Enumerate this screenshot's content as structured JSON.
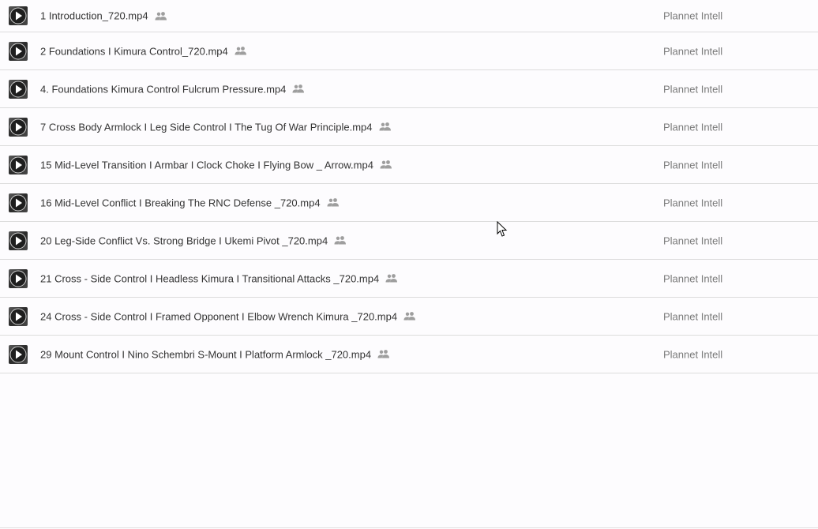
{
  "files": [
    {
      "name": "1 Introduction_720.mp4",
      "owner": "Plannet Intell",
      "icon": "video-play-icon",
      "shared": true
    },
    {
      "name": "2 Foundations I Kimura Control_720.mp4",
      "owner": "Plannet Intell",
      "icon": "video-play-icon",
      "shared": true
    },
    {
      "name": "4. Foundations  Kimura Control  Fulcrum Pressure.mp4",
      "owner": "Plannet Intell",
      "icon": "video-play-icon",
      "shared": true
    },
    {
      "name": "7 Cross Body Armlock I Leg Side Control I The Tug Of War Principle.mp4",
      "owner": "Plannet Intell",
      "icon": "video-play-icon",
      "shared": true
    },
    {
      "name": "15 Mid-Level Transition I Armbar I Clock Choke I Flying Bow _ Arrow.mp4",
      "owner": "Plannet Intell",
      "icon": "video-play-icon",
      "shared": true
    },
    {
      "name": "16 Mid-Level Conflict I Breaking The RNC Defense _720.mp4",
      "owner": "Plannet Intell",
      "icon": "video-play-icon",
      "shared": true
    },
    {
      "name": "20 Leg-Side Conflict  Vs. Strong Bridge I Ukemi Pivot _720.mp4",
      "owner": "Plannet Intell",
      "icon": "video-play-icon",
      "shared": true
    },
    {
      "name": "21 Cross - Side Control I Headless Kimura I Transitional Attacks _720.mp4",
      "owner": "Plannet Intell",
      "icon": "video-play-icon",
      "shared": true
    },
    {
      "name": "24 Cross - Side Control I Framed Opponent I Elbow Wrench Kimura _720.mp4",
      "owner": "Plannet Intell",
      "icon": "video-play-icon",
      "shared": true
    },
    {
      "name": "29 Mount Control I Nino Schembri S-Mount I Platform Armlock _720.mp4",
      "owner": "Plannet Intell",
      "icon": "video-play-icon",
      "shared": true
    }
  ],
  "colors": {
    "background": "#fdfcfe",
    "divider": "#dcdcdc",
    "file_name_text": "#333333",
    "owner_text": "#7a7a7a",
    "shared_icon": "#9e9e9e"
  }
}
